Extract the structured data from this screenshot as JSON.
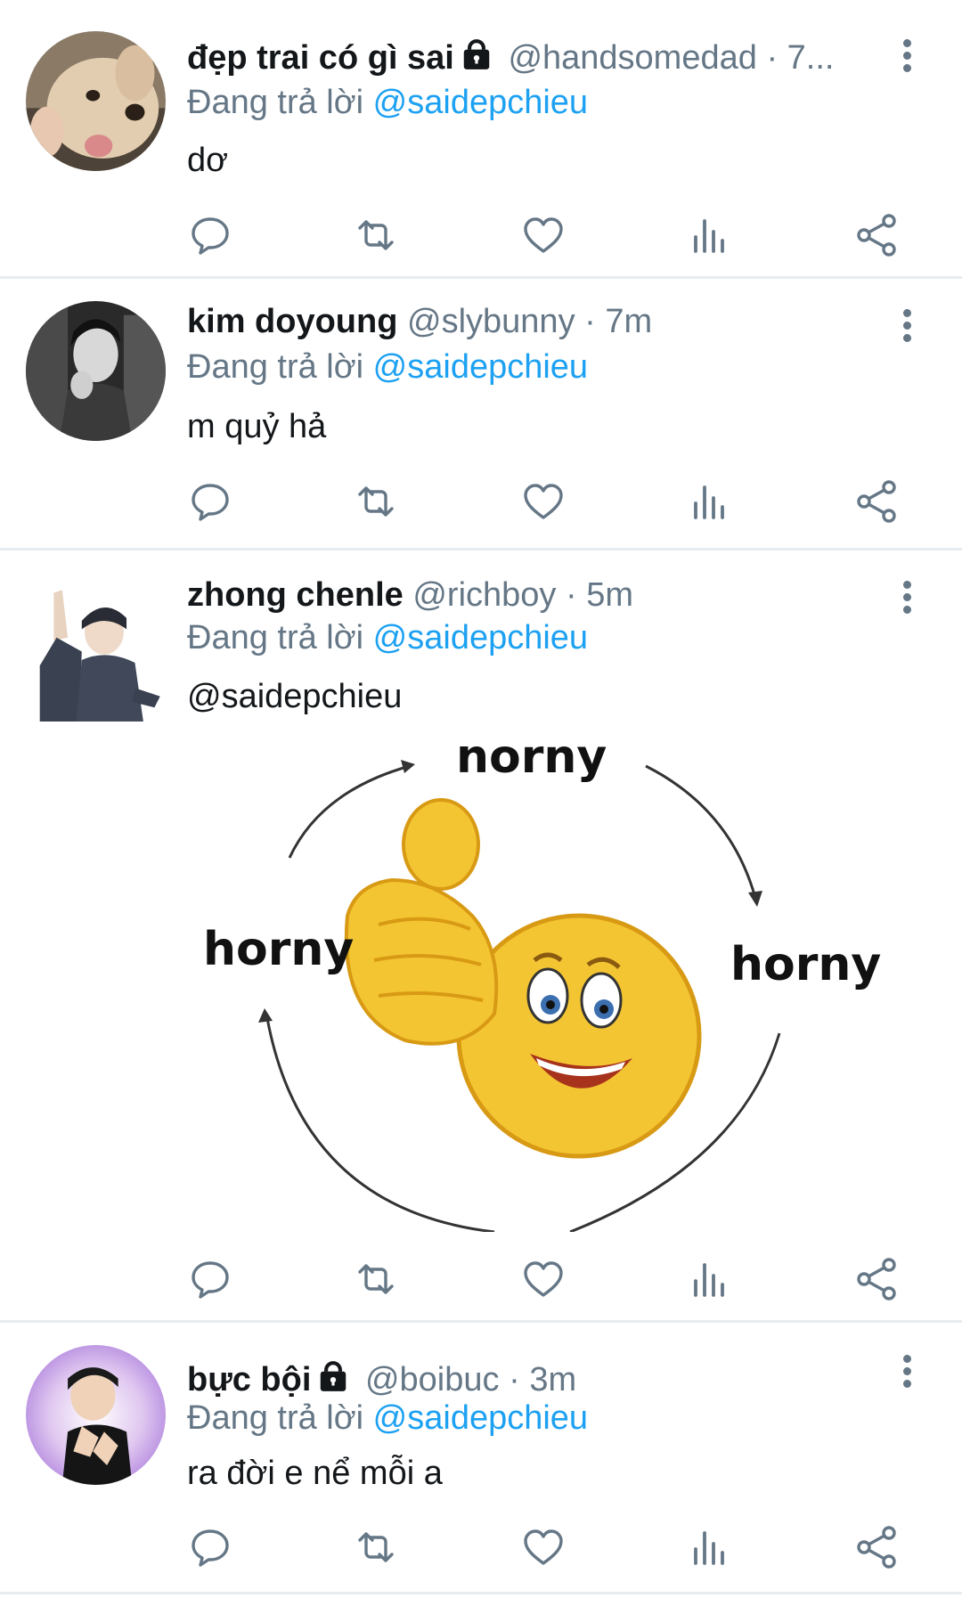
{
  "tweets": [
    {
      "name": "đẹp trai có gì sai",
      "handle": "@handsomedad",
      "dot": "·",
      "time": "7...",
      "replying_label": "Đang trả lời",
      "replying_to": "@saidepchieu",
      "text": "dơ",
      "locked": true
    },
    {
      "name": "kim doyoung",
      "handle": "@slybunny",
      "dot": "·",
      "time": "7m",
      "replying_label": "Đang trả lời",
      "replying_to": "@saidepchieu",
      "text": "m quỷ hả",
      "locked": false
    },
    {
      "name": "zhong chenle",
      "handle": "@richboy",
      "dot": "·",
      "time": "5m",
      "replying_label": "Đang trả lời",
      "replying_to": "@saidepchieu",
      "text": "@saidepchieu",
      "locked": false,
      "media_labels": [
        "horny",
        "horny",
        "horny"
      ]
    },
    {
      "name": "bực bội",
      "handle": "@boibuc",
      "dot": "·",
      "time": "3m",
      "replying_label": "Đang trả lời",
      "replying_to": "@saidepchieu",
      "text": "ra đời e nể mỗi a",
      "locked": true
    }
  ],
  "actions": [
    "reply-icon",
    "retweet-icon",
    "like-icon",
    "analytics-icon",
    "share-icon"
  ],
  "colors": {
    "name": "#14171a",
    "secondary": "#657786",
    "mention": "#1da1f2",
    "divider": "#e6ecf0"
  }
}
